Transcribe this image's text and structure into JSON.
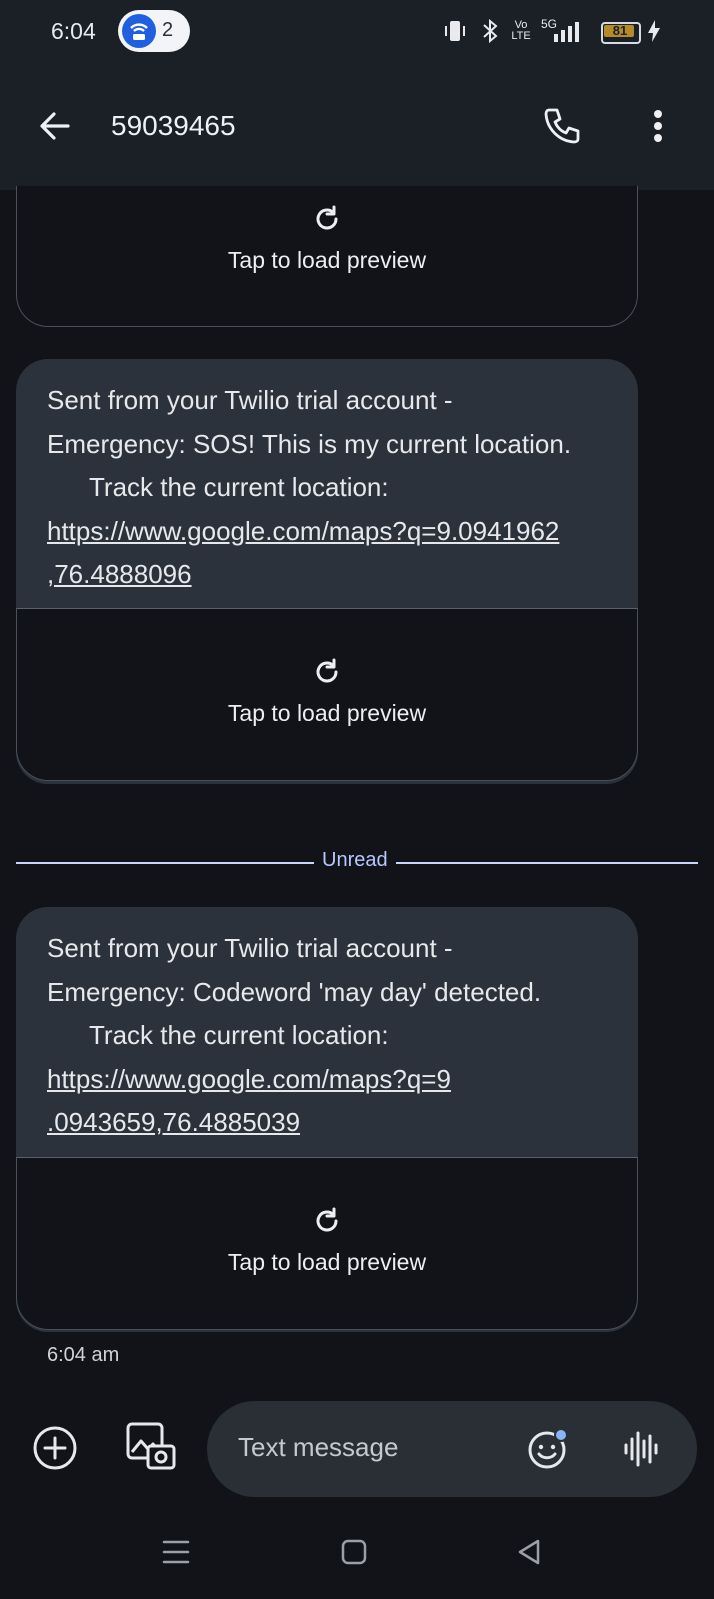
{
  "status_bar": {
    "time": "6:04",
    "notification_count": "2",
    "network_label": "5G",
    "volte_label": "Vo LTE",
    "battery_level": "81"
  },
  "header": {
    "title": "59039465",
    "icons": [
      "back-arrow-icon",
      "phone-icon",
      "more-vert-icon"
    ]
  },
  "messages": [
    {
      "preview_label": "Tap to load preview"
    },
    {
      "line1": "Sent from your Twilio trial account -",
      "line2": "Emergency: SOS! This is my current location.",
      "line3": "Track the current location:",
      "link_line1": "https://www.google.com/maps?q=9.0941962",
      "link_line2": ",76.4888096",
      "preview_label": "Tap to load preview"
    },
    {
      "line1": "Sent from your Twilio trial account -",
      "line2": "Emergency: Codeword 'may day' detected.",
      "line3": "Track the current location:",
      "link_line1": "https://www.google.com/maps?q=9",
      "link_line2": ".0943659,76.4885039",
      "preview_label": "Tap to load preview",
      "time": "6:04 am"
    }
  ],
  "divider": {
    "label": "Unread"
  },
  "compose": {
    "placeholder": "Text message"
  },
  "colors": {
    "background": "#111318",
    "bubble": "#2c323b",
    "accent_divider": "#c9d4ff",
    "notification_blue": "#2060e0"
  }
}
